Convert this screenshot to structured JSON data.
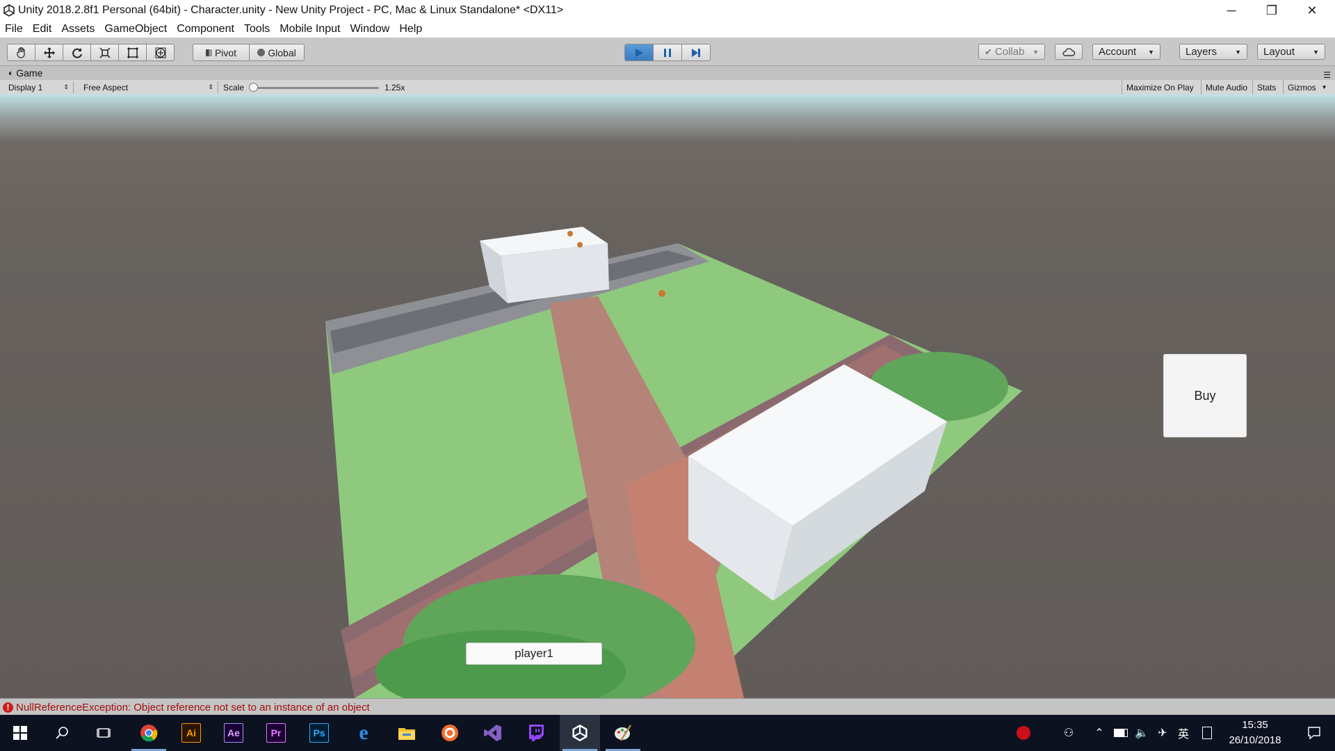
{
  "window": {
    "title": "Unity 2018.2.8f1 Personal (64bit) - Character.unity - New Unity Project - PC, Mac & Linux Standalone* <DX11>",
    "controls": {
      "minimize": "─",
      "restore": "❐",
      "close": "✕"
    }
  },
  "menubar": {
    "items": [
      "File",
      "Edit",
      "Assets",
      "GameObject",
      "Component",
      "Tools",
      "Mobile Input",
      "Window",
      "Help"
    ]
  },
  "toolbar": {
    "transform_tools": [
      "hand-icon",
      "move-icon",
      "rotate-icon",
      "scale-icon",
      "rect-tool-icon",
      "transform-tool-icon"
    ],
    "pivot_label": "Pivot",
    "global_label": "Global",
    "play_controls": [
      "play-icon",
      "pause-icon",
      "step-icon"
    ],
    "collab_label": "Collab",
    "account_label": "Account",
    "layers_label": "Layers",
    "layout_label": "Layout",
    "accent": "#3a7bc0"
  },
  "game_view": {
    "tab_label": "Game",
    "display": "Display 1",
    "aspect": "Free Aspect",
    "scale_label": "Scale",
    "scale_value": "1.25x",
    "maximize_label": "Maximize On Play",
    "mute_label": "Mute Audio",
    "stats_label": "Stats",
    "gizmos_label": "Gizmos",
    "buy_button": "Buy",
    "player_name": "player1"
  },
  "status": {
    "message": "NullReferenceException: Object reference not set to an instance of an object",
    "color": "#a30d0d"
  },
  "taskbar": {
    "apps": [
      "windows-start-icon",
      "search-icon",
      "task-view-icon",
      "chrome-icon",
      "illustrator-icon",
      "after-effects-icon",
      "premiere-icon",
      "photoshop-icon",
      "edge-icon",
      "file-explorer-icon",
      "origin-icon",
      "visual-studio-icon",
      "twitch-icon",
      "unity-icon",
      "paint-icon"
    ],
    "app_labels": {
      "illustrator": "Ai",
      "after_effects": "Ae",
      "premiere": "Pr",
      "photoshop": "Ps"
    },
    "tray_language": "英",
    "time": "15:35",
    "date": "26/10/2018"
  }
}
